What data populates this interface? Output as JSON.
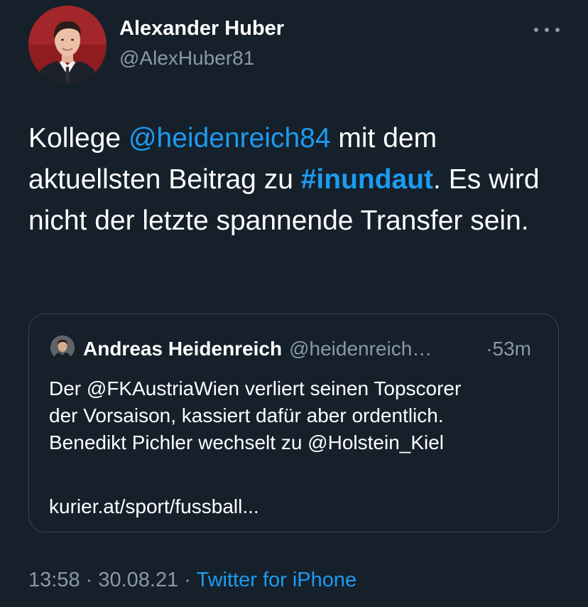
{
  "author": {
    "display_name": "Alexander Huber",
    "handle": "@AlexHuber81"
  },
  "menu_icon": "more-horizontal-icon",
  "tweet": {
    "text_parts": {
      "p1": "Kollege ",
      "mention": "@heidenreich84",
      "p2": " mit dem aktuellsten Beitrag zu ",
      "hashtag": "#inundaut",
      "p3": ". Es wird nicht der letzte spannende Transfer sein."
    }
  },
  "quoted_tweet": {
    "author_name": "Andreas Heidenreich",
    "author_handle": "@heidenreich…",
    "time": "·53m",
    "lines": [
      "Der @FKAustriaWien verliert seinen Topscorer",
      "der Vorsaison, kassiert dafür aber ordentlich.",
      "Benedikt Pichler wechselt zu @Holstein_Kiel"
    ],
    "url": "kurier.at/sport/fussball..."
  },
  "meta": {
    "time": "13:58",
    "date": "30.08.21",
    "sep1": " · ",
    "sep2": " · ",
    "source": "Twitter for iPhone"
  },
  "colors": {
    "background": "#15202b",
    "accent": "#1d9bf0",
    "secondary_text": "#8b98a5",
    "border": "#38444d"
  }
}
